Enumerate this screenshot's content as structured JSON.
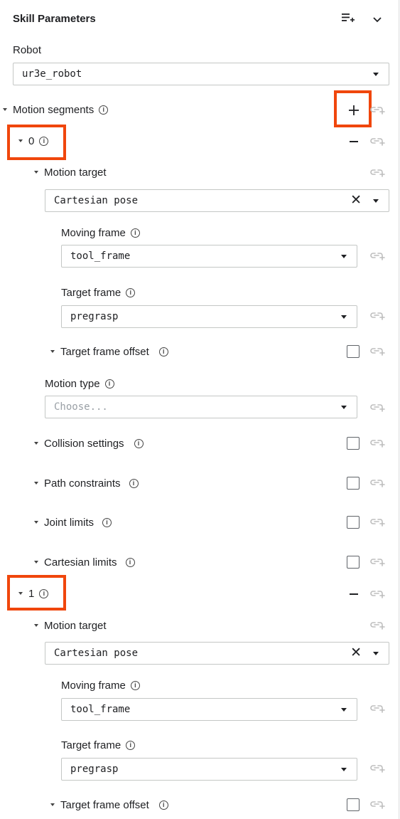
{
  "header": {
    "title": "Skill Parameters"
  },
  "robot": {
    "label": "Robot",
    "value": "ur3e_robot"
  },
  "motion_segments": {
    "label": "Motion segments"
  },
  "segments": [
    {
      "index": "0",
      "motion_target": {
        "label": "Motion target",
        "value": "Cartesian pose"
      },
      "moving_frame": {
        "label": "Moving frame",
        "value": "tool_frame"
      },
      "target_frame": {
        "label": "Target frame",
        "value": "pregrasp"
      },
      "target_frame_offset": {
        "label": "Target frame offset"
      },
      "motion_type": {
        "label": "Motion type",
        "placeholder": "Choose..."
      },
      "collision_settings": {
        "label": "Collision settings"
      },
      "path_constraints": {
        "label": "Path constraints"
      },
      "joint_limits": {
        "label": "Joint limits"
      },
      "cartesian_limits": {
        "label": "Cartesian limits"
      }
    },
    {
      "index": "1",
      "motion_target": {
        "label": "Motion target",
        "value": "Cartesian pose"
      },
      "moving_frame": {
        "label": "Moving frame",
        "value": "tool_frame"
      },
      "target_frame": {
        "label": "Target frame",
        "value": "pregrasp"
      },
      "target_frame_offset": {
        "label": "Target frame offset"
      }
    }
  ],
  "icons": {
    "add_list": "playlist-add-icon",
    "collapse": "chevron-down-icon",
    "link": "link-add-icon",
    "info": "info-icon",
    "add": "plus-icon",
    "remove": "minus-icon",
    "clear": "close-icon"
  },
  "colors": {
    "highlight": "#f0460c",
    "text": "#202124",
    "link_icon": "#bdbdbd"
  }
}
